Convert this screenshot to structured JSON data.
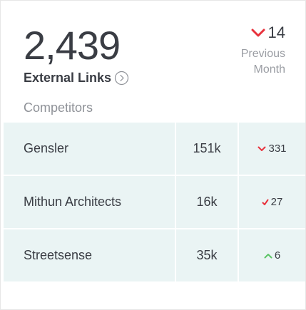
{
  "widget": {
    "total_value": "2,439",
    "metric_label": "External Links",
    "change_value": "14",
    "change_direction": "down",
    "comparison_label_line1": "Previous",
    "comparison_label_line2": "Month",
    "section_label": "Competitors"
  },
  "competitors": [
    {
      "name": "Gensler",
      "value": "151k",
      "change": "331",
      "direction": "down"
    },
    {
      "name": "Mithun Architects",
      "value": "16k",
      "change": "27",
      "direction": "down"
    },
    {
      "name": "Streetsense",
      "value": "35k",
      "change": "6",
      "direction": "up"
    }
  ],
  "colors": {
    "down": "#e8323c",
    "up": "#5cc466",
    "text": "#3a3d44",
    "muted": "#9a9da3",
    "row_bg": "#eaf4f4"
  },
  "icons": {
    "info": "info-circle-icon",
    "down": "chevron-down-icon",
    "up": "chevron-up-icon"
  }
}
